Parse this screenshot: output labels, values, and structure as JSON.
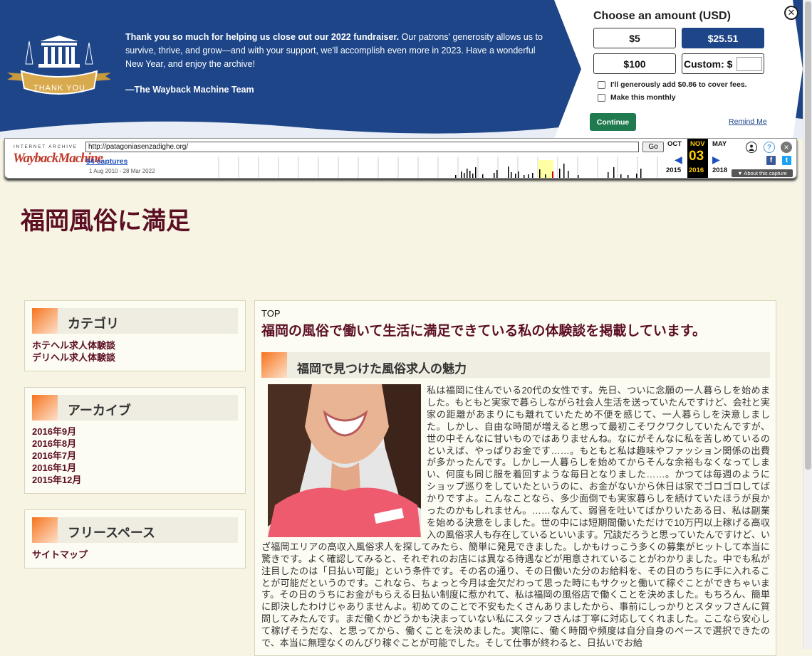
{
  "banner": {
    "message_bold": "Thank you so much for helping us close out our 2022 fundraiser.",
    "message_rest": " Our patrons' generosity allows us to survive, thrive, and grow—and with your support, we'll accomplish even more in 2023. Have a wonderful New Year, and enjoy the archive!",
    "signature": "—The Wayback Machine Team",
    "logo_ribbon": "THANK YOU",
    "panel_title": "Choose an amount (USD)",
    "amounts": [
      "$5",
      "$25.51",
      "$100",
      "Custom: $"
    ],
    "selected_amount": "$25.51",
    "cover_fees": "I'll generously add $0.86 to cover fees.",
    "monthly": "Make this monthly",
    "continue": "Continue",
    "remind": "Remind Me",
    "close": "✕"
  },
  "wayback": {
    "ia_text": "INTERNET ARCHIVE",
    "logo_text": "WaybackMachine",
    "url": "http://patagoniasenzadighe.org/",
    "go": "Go",
    "captures": "94 captures",
    "range": "1 Aug 2010 - 28 Mar 2022",
    "prev_month": "OCT",
    "cur_month": "NOV",
    "next_month": "MAY",
    "cur_day": "03",
    "prev_year": "2015",
    "cur_year": "2016",
    "next_year": "2018",
    "about": "▼ About this capture",
    "help": "?",
    "x": "✕",
    "fb": "f",
    "tw": "t"
  },
  "site": {
    "title": "福岡風俗に満足"
  },
  "sidebar": [
    {
      "heading": "カテゴリ",
      "links": [
        "ホテヘル求人体験談",
        "デリヘル求人体験談"
      ]
    },
    {
      "heading": "アーカイブ",
      "links": [
        "2016年9月",
        "2016年8月",
        "2016年7月",
        "2016年1月",
        "2015年12月"
      ]
    },
    {
      "heading": "フリースペース",
      "links": [
        "サイトマップ"
      ]
    }
  ],
  "main": {
    "breadcrumb": "TOP",
    "lead": "福岡の風俗で働いて生活に満足できている私の体験談を掲載しています。",
    "section_title": "福岡で見つけた風俗求人の魅力",
    "body": "私は福岡に住んでいる20代の女性です。先日、ついに念願の一人暮らしを始めました。もともと実家で暮らしながら社会人生活を送っていたんですけど、会社と実家の距離があまりにも離れていたため不便を感じて、一人暮らしを決意しました。しかし、自由な時間が増えると思って最初こそワクワクしていたんですが、世の中そんなに甘いものではありませんね。なにがそんなに私を苦しめているのといえば、やっぱりお金です……。もともと私は趣味やファッション関係の出費が多かったんです。しかし一人暮らしを始めてからそんな余裕もなくなってしまい、何度も同じ服を着回すような毎日となりました……。かつては毎週のようにショップ巡りをしていたというのに、お金がないから休日は家でゴロゴロしてばかりですよ。こんなことなら、多少面倒でも実家暮らしを続けていたほうが良かったのかもしれません。……なんて、弱音を吐いてばかりいたある日、私は副業を始める決意をしました。世の中には短期間働いただけで10万円以上稼げる高収入の風俗求人も存在しているといいます。冗談だろうと思っていたんですけど、いざ福岡エリアの高収入風俗求人を探してみたら、簡単に発見できました。しかもけっこう多くの募集がヒットして本当に驚きです。よく確認してみると、それぞれのお店には異なる待遇などが用意されていることがわかりました。中でも私が注目したのは「日払い可能」という条件です。その名の通り、その日働いた分のお給料を、その日のうちに手に入れることが可能だというのです。これなら、ちょっと今月は金欠だわって思った時にもサクッと働いて稼ぐことができちゃいます。その日のうちにお金がもらえる日払い制度に惹かれて、私は福岡の風俗店で働くことを決めました。もちろん、簡単に即決したわけじゃありませんよ。初めてのことで不安もたくさんありましたから、事前にしっかりとスタッフさんに質問してみたんです。まだ働くかどうかも決まっていない私にスタッフさんは丁寧に対応してくれました。ここなら安心して稼げそうだな、と思ってから、働くことを決めました。実際に、働く時間や頻度は自分自身のペースで選択できたので、本当に無理なくのんびり稼ぐことが可能でした。そして仕事が終わると、日払いでお給"
  },
  "colors": {
    "banner": "#1d4588",
    "accent": "#5c0f23",
    "continue": "#1f7a4f",
    "page_bg": "#f7f4e4"
  }
}
